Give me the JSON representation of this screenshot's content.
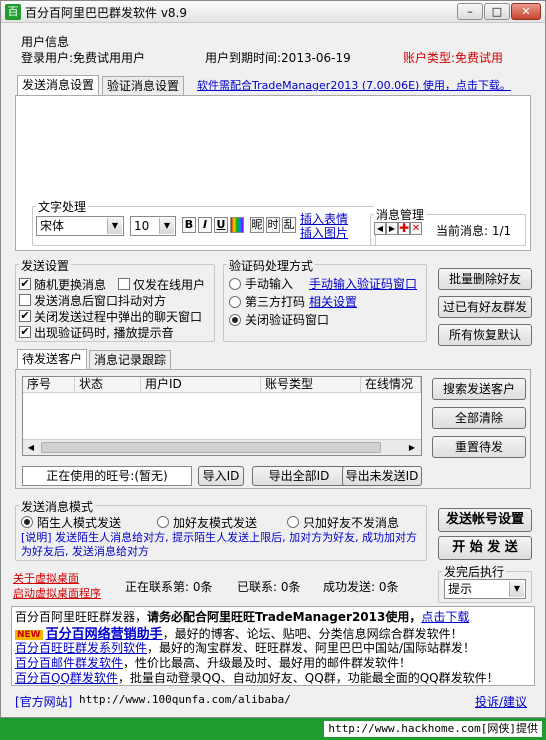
{
  "window": {
    "title": "百分百阿里巴巴群发软件 v8.9",
    "btn_min": "–",
    "btn_max": "□",
    "btn_close": "✕"
  },
  "user_info": {
    "group_label": "用户信息",
    "login_user": "登录用户:免费试用用户",
    "expire": "用户到期时间:2013-06-19",
    "account_type": "账户类型:免费试用"
  },
  "message_tabs": {
    "tab_send": "发送消息设置",
    "tab_verify": "验证消息设置",
    "notice_link": "软件需配合TradeManager2013 (7.00.06E) 使用，点击下载。"
  },
  "text_processing": {
    "group_label": "文字处理",
    "font_value": "宋体",
    "size_value": "10",
    "bold": "B",
    "italic": "I",
    "underline": "U",
    "btn_nickname": "昵",
    "btn_time": "时",
    "btn_random": "乱",
    "insert_emoji": "插入表情",
    "insert_image": "插入图片"
  },
  "message_manage": {
    "group_label": "消息管理",
    "current": "当前消息: 1/1"
  },
  "send_settings": {
    "group_label": "发送设置",
    "opt_random_switch": "随机更换消息",
    "opt_online_only": "仅发在线用户",
    "opt_shake": "发送消息后窗口抖动对方",
    "opt_close_popup": "关闭发送过程中弹出的聊天窗口",
    "opt_sound": "出现验证码时, 播放提示音"
  },
  "captcha": {
    "group_label": "验证码处理方式",
    "opt_manual": "手动输入",
    "manual_link": "手动输入验证码窗口",
    "opt_third": "第三方打码",
    "third_link": "相关设置",
    "opt_close": "关闭验证码窗口"
  },
  "right_buttons": {
    "batch_delete": "批量删除好友",
    "filter_friends": "过已有好友群发",
    "restore_default": "所有恢复默认"
  },
  "customer_tabs": {
    "tab_pending": "待发送客户",
    "tab_log": "消息记录跟踪"
  },
  "table": {
    "columns": [
      "序号",
      "状态",
      "用户ID",
      "账号类型",
      "在线情况"
    ]
  },
  "customer_buttons": {
    "search": "搜索发送客户",
    "clear_all": "全部清除",
    "reset": "重置待发"
  },
  "id_row": {
    "current_id": "正在使用的旺号:(暂无)",
    "import": "导入ID",
    "export_all": "导出全部ID",
    "export_unsent": "导出未发送ID"
  },
  "send_mode": {
    "group_label": "发送消息模式",
    "opt_stranger": "陌生人模式发送",
    "opt_add_friend": "加好友模式发送",
    "opt_add_only": "只加好友不发消息",
    "description": "[说明] 发送陌生人消息给对方, 提示陌生人发送上限后, 加对方为好友, 成功加对方为好友后, 发送消息给对方"
  },
  "main_buttons": {
    "account_settings": "发送帐号设置",
    "start_send": "开 始 发 送"
  },
  "virtual_desktop": {
    "close": "关于虚拟桌面",
    "start": "启动虚拟桌面程序"
  },
  "stats": {
    "contacting": "正在联系第: 0条",
    "contacted": "已联系: 0条",
    "success": "成功发送: 0条"
  },
  "after_send": {
    "group_label": "发完后执行",
    "value": "提示"
  },
  "ads": {
    "line1_prefix": "百分百阿里旺旺群发器，",
    "line1_bold": "请务必配合阿里旺旺TradeManager2013使用，",
    "line1_link": "点击下载",
    "line2_badge": "NEW",
    "line2_link": "百分百网络营销助手",
    "line2_rest": "，最好的博客、论坛、贴吧、分类信息网综合群发软件！",
    "line3_link": "百分百旺旺群发系列软件",
    "line3_rest": "，最好的淘宝群发、旺旺群发、阿里巴巴中国站/国际站群发！",
    "line4_link": "百分百邮件群发软件",
    "line4_rest": "，性价比最高、升级最及时、最好用的邮件群发软件！",
    "line5_link": "百分百QQ群发软件",
    "line5_rest": "，批量自动登录QQ、自动加好友、QQ群，功能最全面的QQ群发软件！"
  },
  "bottom_bar": {
    "official": "[官方网站]",
    "url": "http://www.100qunfa.com/alibaba/",
    "feedback": "投诉/建议"
  },
  "watermark": "http://www.hackhome.com[网侠]提供",
  "colors": {
    "accent_green": "#1e9c2f",
    "link_blue": "#0000cc",
    "alert_red": "#d40000"
  }
}
